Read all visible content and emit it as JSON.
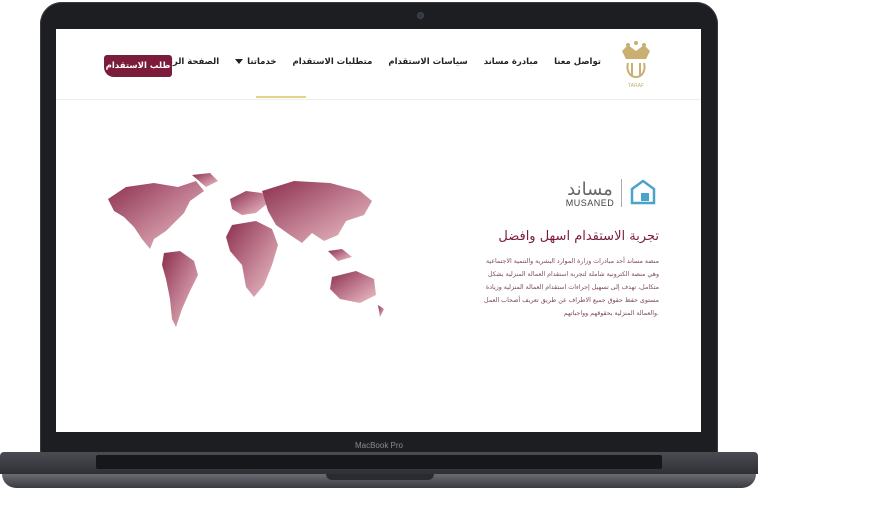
{
  "device": {
    "model_label": "MacBook Pro"
  },
  "nav": {
    "logo_text": "TARAF",
    "items": [
      {
        "label": "الصفحة الرئيسية"
      },
      {
        "label": "خدماتنا"
      },
      {
        "label": "متطلبات الاستقدام"
      },
      {
        "label": "سياسات الاستقدام"
      },
      {
        "label": "مبادرة مساند"
      },
      {
        "label": "تواصل معنا"
      }
    ],
    "cta_label": "طلب الاستقدام"
  },
  "hero": {
    "brand_ar": "مساند",
    "brand_en": "MUSANED",
    "headline": "تجربة الاستقدام اسهل وافضل",
    "body_lines": [
      "منصة مساند أحد مبادرات وزارة الموارد البشرية والتنمية الاجتماعية",
      "وهي منصة الكترونية شاملة لتجربة استقدام العمالة المنزلية بشكل",
      "متكامل، تهدف إلى تسهيل إجراءات استقدام العمالة المنزلية وزيادة",
      "مستوى حفظ حقوق جميع الاطراف عن طريق تعريف أصحاب العمل",
      ".والعمالة المنزلية بحقوقهم وواجباتهم"
    ]
  },
  "colors": {
    "brand": "#7b1c3b",
    "accent": "#e5d28f"
  },
  "icons": {
    "dropdown": "chevron-down-icon",
    "logo": "crown-logo-icon",
    "musaned": "musaned-logo-icon",
    "map": "world-map-image"
  }
}
